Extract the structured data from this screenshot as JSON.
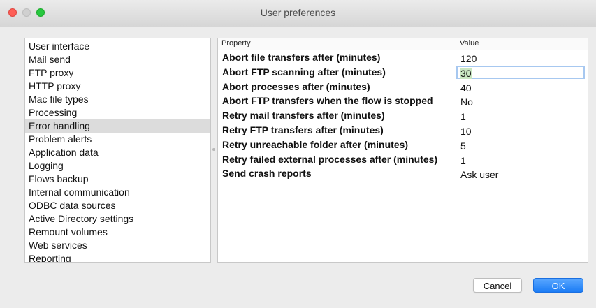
{
  "window": {
    "title": "User preferences"
  },
  "categories": {
    "selected_index": 6,
    "items": [
      "User interface",
      "Mail send",
      "FTP proxy",
      "HTTP proxy",
      "Mac file types",
      "Processing",
      "Error handling",
      "Problem alerts",
      "Application data",
      "Logging",
      "Flows backup",
      "Internal communication",
      "ODBC data sources",
      "Active Directory settings",
      "Remount volumes",
      "Web services",
      "Reporting"
    ]
  },
  "properties": {
    "header_property": "Property",
    "header_value": "Value",
    "editing_index": 1,
    "rows": [
      {
        "name": "Abort file transfers after (minutes)",
        "value": "120"
      },
      {
        "name": "Abort FTP scanning after (minutes)",
        "value": "30"
      },
      {
        "name": "Abort processes after (minutes)",
        "value": "40"
      },
      {
        "name": "Abort FTP transfers when the flow is stopped",
        "value": "No"
      },
      {
        "name": "Retry mail transfers after (minutes)",
        "value": "1"
      },
      {
        "name": "Retry FTP transfers after (minutes)",
        "value": "10"
      },
      {
        "name": "Retry unreachable folder after (minutes)",
        "value": "5"
      },
      {
        "name": "Retry failed external processes after (minutes)",
        "value": "1"
      },
      {
        "name": "Send crash reports",
        "value": "Ask user"
      }
    ]
  },
  "buttons": {
    "cancel": "Cancel",
    "ok": "OK"
  },
  "colors": {
    "accent": "#1b7cf5",
    "selection": "#dcdcdc",
    "edit_focus": "#a7c8f0"
  }
}
